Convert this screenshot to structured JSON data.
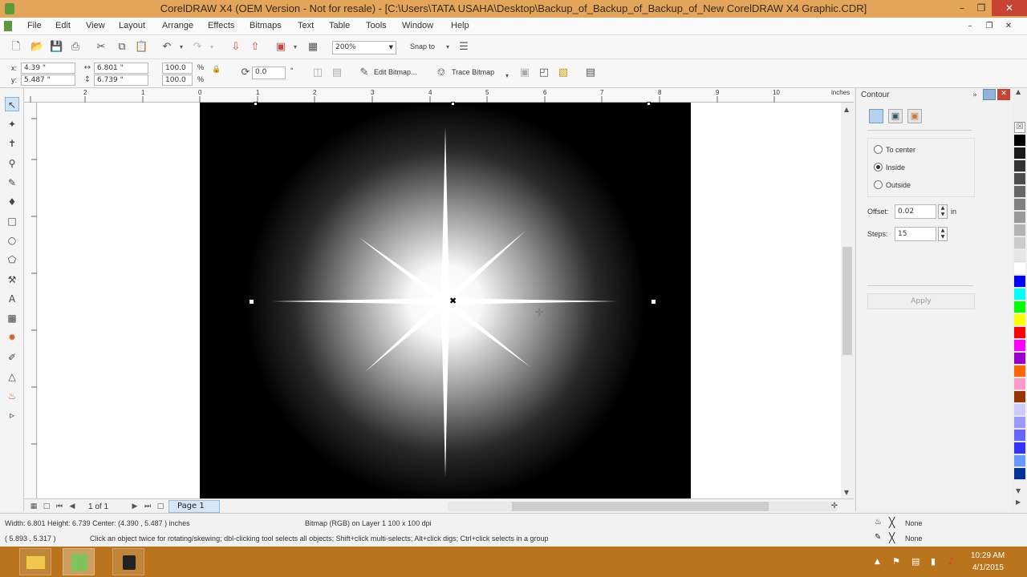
{
  "window": {
    "title": "CorelDRAW X4 (OEM Version - Not for resale) - [C:\\Users\\TATA USAHA\\Desktop\\Backup_of_Backup_of_Backup_of_New CorelDRAW X4 Graphic.CDR]"
  },
  "menu": [
    "File",
    "Edit",
    "View",
    "Layout",
    "Arrange",
    "Effects",
    "Bitmaps",
    "Text",
    "Table",
    "Tools",
    "Window",
    "Help"
  ],
  "toolbar": {
    "zoom": "200%",
    "snap_to": "Snap to"
  },
  "propbar": {
    "x_label": "x:",
    "x": "4.39 \"",
    "y_label": "y:",
    "y": "5.487 \"",
    "w": "6.801 \"",
    "h": "6.739 \"",
    "scale_w": "100.0",
    "scale_h": "100.0",
    "pct": "%",
    "angle": "0.0",
    "deg": "°",
    "edit_bitmap": "Edit Bitmap...",
    "trace_bitmap": "Trace Bitmap"
  },
  "ruler": {
    "units": "inches",
    "labels": [
      "2",
      "1",
      "0",
      "1",
      "2",
      "3",
      "4",
      "5",
      "6",
      "7",
      "8",
      "9",
      "10"
    ]
  },
  "page_nav": {
    "count": "1 of 1",
    "page_tab": "Page 1"
  },
  "docker": {
    "title": "Contour",
    "options": [
      "To center",
      "Inside",
      "Outside"
    ],
    "selected": "Inside",
    "offset_label": "Offset:",
    "offset_value": "0.02",
    "offset_unit": "in",
    "steps_label": "Steps:",
    "steps_value": "15",
    "apply": "Apply"
  },
  "palette": [
    "#000000",
    "#1a1a1a",
    "#333333",
    "#4d4d4d",
    "#666666",
    "#808080",
    "#999999",
    "#b3b3b3",
    "#cccccc",
    "#e6e6e6",
    "#ffffff",
    "#0000ff",
    "#00ffff",
    "#00ff00",
    "#ffff00",
    "#ff0000",
    "#ff00ff",
    "#9900cc",
    "#ff6600",
    "#ff99cc",
    "#993300",
    "#ccccff",
    "#9999ff",
    "#6666ff",
    "#3333ff",
    "#6699ff",
    "#003399"
  ],
  "status": {
    "size": "Width: 6.801  Height: 6.739  Center: (4.390 , 5.487 )  inches",
    "object": "Bitmap (RGB) on Layer 1 100 x 100 dpi",
    "cursor": "( 5.893 , 5.317 )",
    "hint": "Click an object twice for rotating/skewing; dbl-clicking tool selects all objects; Shift+click multi-selects; Alt+click digs; Ctrl+click selects in a group",
    "fill": "None",
    "outline": "None"
  },
  "taskbar": {
    "time": "10:29 AM",
    "date": "4/1/2015"
  }
}
